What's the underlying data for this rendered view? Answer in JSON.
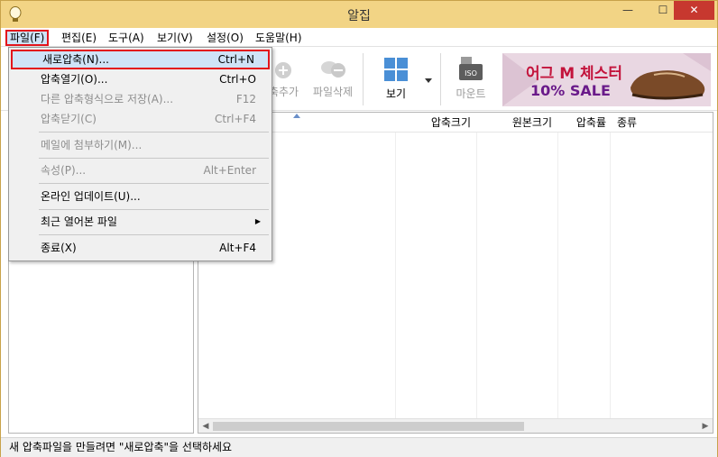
{
  "window": {
    "title": "알집",
    "min_symbol": "—",
    "max_symbol": "☐",
    "close_symbol": "✕",
    "accent_color": "#f2d485",
    "close_color": "#c7382f"
  },
  "menubar": [
    {
      "label": "파일(F)",
      "active": true
    },
    {
      "label": "편집(E)"
    },
    {
      "label": "도구(A)"
    },
    {
      "label": "보기(V)"
    },
    {
      "label": "설정(O)"
    },
    {
      "label": "도움말(H)"
    }
  ],
  "toolbar": {
    "add_label": "압축추가",
    "delete_label": "파일삭제",
    "view_label": "보기",
    "mount_label": "마운트",
    "iso_text": "ISO"
  },
  "ad": {
    "line1": "어그 M 체스터",
    "line2": "10% SALE"
  },
  "columns": [
    "압축크기",
    "원본크기",
    "압축률",
    "종류"
  ],
  "status": "새 압축파일을 만들려면 \"새로압축\"을 선택하세요",
  "file_menu": {
    "items": [
      {
        "label": "새로압축(N)...",
        "shortcut": "Ctrl+N",
        "selected": true
      },
      {
        "label": "압축열기(O)...",
        "shortcut": "Ctrl+O"
      },
      {
        "label": "다른 압축형식으로 저장(A)...",
        "shortcut": "F12",
        "disabled": true
      },
      {
        "label": "압축닫기(C)",
        "shortcut": "Ctrl+F4",
        "disabled": true
      },
      {
        "label": "메일에 첨부하기(M)...",
        "shortcut": "",
        "disabled": true
      },
      {
        "label": "속성(P)...",
        "shortcut": "Alt+Enter",
        "disabled": true
      },
      {
        "label": "온라인 업데이트(U)...",
        "shortcut": ""
      },
      {
        "label": "최근 열어본 파일",
        "shortcut": "",
        "submenu_arrow": "▶"
      },
      {
        "label": "종료(X)",
        "shortcut": "Alt+F4"
      }
    ]
  },
  "scroll": {
    "left_arrow": "◀",
    "right_arrow": "▶"
  },
  "sort_indicator": "▲"
}
